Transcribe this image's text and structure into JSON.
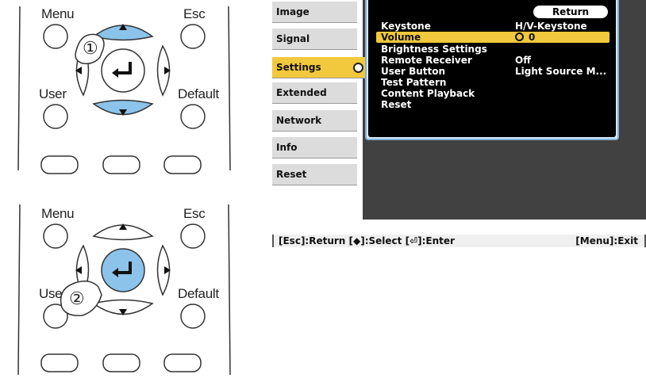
{
  "remote_top": {
    "menu_label": "Menu",
    "esc_label": "Esc",
    "user_label": "User",
    "default_label": "Default",
    "step_label": "①"
  },
  "remote_bottom": {
    "menu_label": "Menu",
    "esc_label": "Esc",
    "user_label": "Use",
    "default_label": "Default",
    "step_label": "②"
  },
  "menu": {
    "sidebar": [
      {
        "label": "Image"
      },
      {
        "label": "Signal"
      },
      {
        "label": "Settings",
        "active": true
      },
      {
        "label": "Extended"
      },
      {
        "label": "Network"
      },
      {
        "label": "Info"
      },
      {
        "label": "Reset"
      }
    ],
    "return_label": "Return",
    "rows": [
      {
        "label": "Keystone",
        "value": "H/V-Keystone"
      },
      {
        "label": "Volume",
        "value": "0"
      },
      {
        "label": "Brightness Settings",
        "value": ""
      },
      {
        "label": "Remote Receiver",
        "value": "Off"
      },
      {
        "label": "User Button",
        "value": "Light Source M..."
      },
      {
        "label": "Test Pattern",
        "value": ""
      },
      {
        "label": "Content Playback",
        "value": ""
      },
      {
        "label": "Reset",
        "value": ""
      }
    ],
    "bottom_left": "[Esc]:Return  [◆]:Select  [⏎]:Enter",
    "bottom_right": "[Menu]:Exit"
  }
}
